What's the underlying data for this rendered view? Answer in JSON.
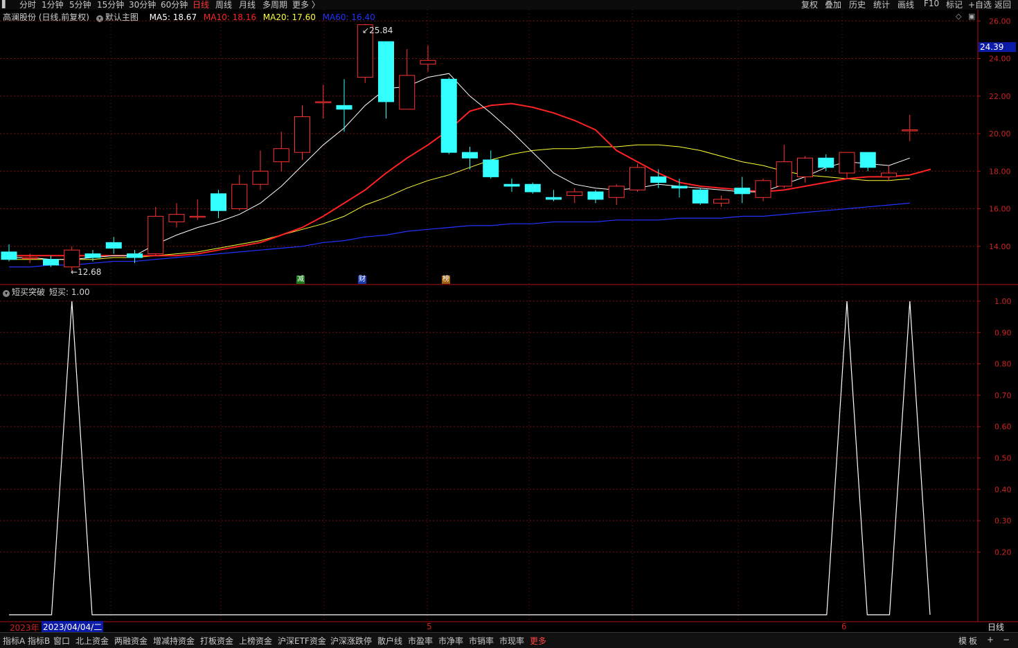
{
  "topbar": {
    "tabs": [
      "分时",
      "1分钟",
      "5分钟",
      "15分钟",
      "30分钟",
      "60分钟",
      "日线",
      "周线",
      "月线",
      "多周期",
      "更多 〉"
    ],
    "active_tab": "日线",
    "tools": [
      "复权",
      "叠加",
      "历史",
      "统计",
      "画线",
      "F10",
      "标记",
      "+自选",
      "返回"
    ]
  },
  "info": {
    "stock": "高澜股份 (日线,前复权)",
    "template": "默认主图",
    "ma5": "MA5: 18.67",
    "ma10": "MA10: 18.16",
    "ma20": "MA20: 17.60",
    "ma60": "MA60: 16.40"
  },
  "indicator": {
    "name": "短买突破",
    "value": "短买: 1.00"
  },
  "annotations": {
    "high_label": "25.84",
    "low_label": "12.68",
    "current_price": "24.39",
    "event_1": "减",
    "event_2": "财",
    "event_3": "榜"
  },
  "axis": {
    "year": "2023年",
    "date": "2023/04/04/二",
    "month5": "5",
    "month6": "6",
    "period": "日线"
  },
  "bottombar": {
    "tabs": [
      "指标A",
      "指标B",
      "窗口",
      "北上资金",
      "两融资金",
      "增减持资金",
      "打板资金",
      "上榜资金",
      "沪深ETF资金",
      "沪深涨跌停",
      "散户线",
      "市盈率",
      "市净率",
      "市销率",
      "市现率",
      "更多"
    ],
    "active_tab": "更多",
    "right": [
      "模",
      "板",
      "+",
      "−"
    ]
  },
  "colors": {
    "up": "#ff3333",
    "down": "#33ffff",
    "ma5": "#ffffff",
    "ma10": "#ff2222",
    "ma20": "#ffff33",
    "ma60": "#2233ff",
    "grid": "#7a1010"
  },
  "chart_data": [
    {
      "type": "candlestick",
      "title": "高澜股份 (日线,前复权)",
      "ylim": [
        12.0,
        26.6
      ],
      "yticks": [
        "26.00",
        "24.00",
        "22.00",
        "20.00",
        "18.00",
        "16.00",
        "14.00"
      ],
      "candles": [
        {
          "o": 13.7,
          "c": 13.3,
          "h": 14.1,
          "l": 13.2
        },
        {
          "o": 13.4,
          "c": 13.4,
          "h": 13.6,
          "l": 13.1
        },
        {
          "o": 13.3,
          "c": 13.0,
          "h": 13.5,
          "l": 12.9
        },
        {
          "o": 12.9,
          "c": 13.8,
          "h": 14.0,
          "l": 12.68
        },
        {
          "o": 13.6,
          "c": 13.4,
          "h": 13.8,
          "l": 13.2
        },
        {
          "o": 14.2,
          "c": 13.9,
          "h": 14.5,
          "l": 13.6
        },
        {
          "o": 13.6,
          "c": 13.4,
          "h": 13.8,
          "l": 13.1
        },
        {
          "o": 13.6,
          "c": 15.6,
          "h": 16.1,
          "l": 13.5
        },
        {
          "o": 15.3,
          "c": 15.7,
          "h": 16.3,
          "l": 15.0
        },
        {
          "o": 15.6,
          "c": 15.6,
          "h": 16.5,
          "l": 15.4
        },
        {
          "o": 16.8,
          "c": 15.9,
          "h": 17.0,
          "l": 15.5
        },
        {
          "o": 16.0,
          "c": 17.3,
          "h": 17.8,
          "l": 15.9
        },
        {
          "o": 17.3,
          "c": 18.0,
          "h": 19.1,
          "l": 17.0
        },
        {
          "o": 18.5,
          "c": 19.2,
          "h": 20.1,
          "l": 18.0
        },
        {
          "o": 19.0,
          "c": 20.9,
          "h": 21.5,
          "l": 18.6
        },
        {
          "o": 21.7,
          "c": 21.7,
          "h": 22.6,
          "l": 20.8
        },
        {
          "o": 21.5,
          "c": 21.3,
          "h": 22.9,
          "l": 20.1
        },
        {
          "o": 23.0,
          "c": 25.8,
          "h": 25.84,
          "l": 22.7
        },
        {
          "o": 24.9,
          "c": 21.7,
          "h": 24.9,
          "l": 20.8
        },
        {
          "o": 21.3,
          "c": 23.1,
          "h": 24.5,
          "l": 21.3
        },
        {
          "o": 23.7,
          "c": 23.9,
          "h": 24.7,
          "l": 23.3
        },
        {
          "o": 22.9,
          "c": 19.0,
          "h": 23.0,
          "l": 18.9
        },
        {
          "o": 19.0,
          "c": 18.7,
          "h": 19.3,
          "l": 18.1
        },
        {
          "o": 18.6,
          "c": 17.7,
          "h": 19.1,
          "l": 17.6
        },
        {
          "o": 17.3,
          "c": 17.2,
          "h": 17.6,
          "l": 16.9
        },
        {
          "o": 17.3,
          "c": 16.9,
          "h": 17.4,
          "l": 16.8
        },
        {
          "o": 16.6,
          "c": 16.5,
          "h": 17.0,
          "l": 16.4
        },
        {
          "o": 16.7,
          "c": 16.9,
          "h": 17.1,
          "l": 16.3
        },
        {
          "o": 16.9,
          "c": 16.5,
          "h": 17.0,
          "l": 16.3
        },
        {
          "o": 16.6,
          "c": 17.2,
          "h": 17.3,
          "l": 16.2
        },
        {
          "o": 17.0,
          "c": 18.2,
          "h": 18.4,
          "l": 16.9
        },
        {
          "o": 17.7,
          "c": 17.4,
          "h": 18.1,
          "l": 17.1
        },
        {
          "o": 17.2,
          "c": 17.1,
          "h": 17.6,
          "l": 16.6
        },
        {
          "o": 17.0,
          "c": 16.3,
          "h": 17.1,
          "l": 16.2
        },
        {
          "o": 16.3,
          "c": 16.5,
          "h": 16.7,
          "l": 16.1
        },
        {
          "o": 17.1,
          "c": 16.8,
          "h": 17.7,
          "l": 16.3
        },
        {
          "o": 16.6,
          "c": 17.5,
          "h": 17.6,
          "l": 16.4
        },
        {
          "o": 17.2,
          "c": 18.5,
          "h": 19.4,
          "l": 17.1
        },
        {
          "o": 17.7,
          "c": 18.7,
          "h": 18.8,
          "l": 17.4
        },
        {
          "o": 18.7,
          "c": 18.2,
          "h": 18.9,
          "l": 18.0
        },
        {
          "o": 17.9,
          "c": 19.0,
          "h": 19.0,
          "l": 17.6
        },
        {
          "o": 19.0,
          "c": 18.2,
          "h": 19.0,
          "l": 18.0
        },
        {
          "o": 17.7,
          "c": 17.9,
          "h": 18.3,
          "l": 17.5
        },
        {
          "o": 20.2,
          "c": 20.2,
          "h": 21.0,
          "l": 19.6
        }
      ],
      "ma5": [
        13.4,
        13.4,
        13.3,
        13.3,
        13.4,
        13.5,
        13.5,
        14.1,
        14.6,
        15.0,
        15.3,
        15.7,
        16.3,
        17.2,
        18.3,
        19.4,
        20.3,
        21.5,
        22.4,
        22.5,
        23.0,
        23.2,
        22.0,
        21.1,
        20.1,
        19.0,
        17.9,
        17.3,
        17.1,
        17.0,
        17.1,
        17.3,
        17.2,
        17.1,
        17.0,
        16.9,
        16.9,
        17.3,
        17.7,
        18.2,
        18.5,
        18.4,
        18.3,
        18.7
      ],
      "ma10": [
        13.5,
        13.5,
        13.5,
        13.5,
        13.5,
        13.5,
        13.5,
        13.5,
        13.5,
        13.6,
        13.8,
        14.0,
        14.2,
        14.6,
        15.0,
        15.6,
        16.3,
        17.0,
        17.9,
        18.7,
        19.4,
        20.2,
        21.2,
        21.5,
        21.6,
        21.4,
        21.1,
        20.7,
        20.2,
        19.1,
        18.5,
        17.9,
        17.4,
        17.2,
        17.1,
        17.0,
        16.9,
        17.0,
        17.2,
        17.4,
        17.6,
        17.7,
        17.7,
        17.8,
        18.1
      ],
      "ma20": [
        13.3,
        13.3,
        13.3,
        13.3,
        13.3,
        13.4,
        13.4,
        13.5,
        13.6,
        13.7,
        13.9,
        14.1,
        14.3,
        14.6,
        14.9,
        15.2,
        15.6,
        16.2,
        16.6,
        17.1,
        17.5,
        17.8,
        18.2,
        18.6,
        18.9,
        19.1,
        19.2,
        19.2,
        19.3,
        19.3,
        19.4,
        19.4,
        19.3,
        19.1,
        18.8,
        18.5,
        18.3,
        18.0,
        17.8,
        17.7,
        17.6,
        17.5,
        17.5,
        17.6
      ],
      "ma60": [
        12.9,
        12.9,
        13.0,
        13.0,
        13.1,
        13.2,
        13.2,
        13.3,
        13.4,
        13.5,
        13.6,
        13.7,
        13.8,
        13.9,
        14.0,
        14.2,
        14.3,
        14.5,
        14.6,
        14.8,
        14.9,
        15.0,
        15.1,
        15.1,
        15.2,
        15.2,
        15.3,
        15.3,
        15.3,
        15.4,
        15.4,
        15.4,
        15.5,
        15.5,
        15.5,
        15.6,
        15.6,
        15.7,
        15.8,
        15.9,
        16.0,
        16.1,
        16.2,
        16.3
      ]
    },
    {
      "type": "line",
      "title": "短买突破",
      "ylim": [
        0,
        1.05
      ],
      "yticks": [
        "1.00",
        "0.90",
        "0.80",
        "0.70",
        "0.60",
        "0.50",
        "0.40",
        "0.30",
        "0.20"
      ],
      "series": [
        {
          "name": "短买",
          "values": [
            0,
            0,
            0,
            1,
            0,
            0,
            0,
            0,
            0,
            0,
            0,
            0,
            0,
            0,
            0,
            0,
            0,
            0,
            0,
            0,
            0,
            0,
            0,
            0,
            0,
            0,
            0,
            0,
            0,
            0,
            0,
            0,
            0,
            0,
            0,
            0,
            0,
            0,
            0,
            0,
            1,
            0,
            0,
            1
          ]
        }
      ]
    }
  ]
}
